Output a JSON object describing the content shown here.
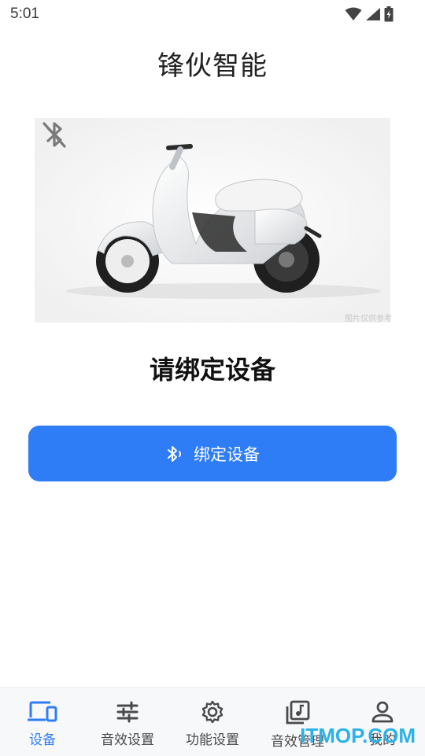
{
  "status_bar": {
    "time": "5:01",
    "icons": [
      "wifi-icon",
      "cellular-signal-icon",
      "battery-charging-icon"
    ]
  },
  "header": {
    "title": "锋伙智能"
  },
  "hero": {
    "image": "scooter-image",
    "bluetooth_status_icon": "bluetooth-disabled-icon",
    "image_caption": "图片仅供参考"
  },
  "main": {
    "prompt": "请绑定设备",
    "bind_button": {
      "icon": "bluetooth-scan-icon",
      "label": "绑定设备"
    }
  },
  "colors": {
    "accent": "#2e7df6",
    "nav_background": "#f7f8fa"
  },
  "bottom_nav": {
    "items": [
      {
        "label": "设备",
        "icon": "devices-icon",
        "active": true
      },
      {
        "label": "音效设置",
        "icon": "sliders-icon",
        "active": false
      },
      {
        "label": "功能设置",
        "icon": "gear-icon",
        "active": false
      },
      {
        "label": "音效管理",
        "icon": "music-library-icon",
        "active": false
      },
      {
        "label": "我的",
        "icon": "person-icon",
        "active": false
      }
    ]
  },
  "watermark": {
    "text": "ITMOP.COM"
  }
}
